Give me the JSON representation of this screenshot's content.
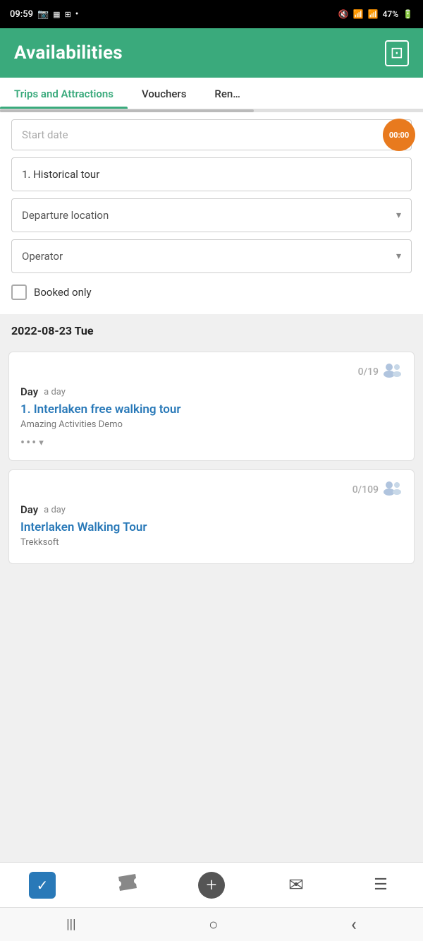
{
  "statusBar": {
    "time": "09:59",
    "battery": "47%",
    "icons": [
      "camera-icon",
      "sim-icon",
      "grid-icon",
      "dot-icon"
    ]
  },
  "header": {
    "title": "Availabilities",
    "layoutIcon": "⊡"
  },
  "tabs": [
    {
      "id": "trips",
      "label": "Trips and Attractions",
      "active": true
    },
    {
      "id": "vouchers",
      "label": "Vouchers",
      "active": false
    },
    {
      "id": "rentals",
      "label": "Ren…",
      "active": false
    }
  ],
  "filters": {
    "startDatePlaceholder": "Start date",
    "timerLabel": "00:00",
    "tourName": "1. Historical tour",
    "departureLocationLabel": "Departure location",
    "operatorLabel": "Operator",
    "bookedOnlyLabel": "Booked only"
  },
  "dateHeading": "2022-08-23 Tue",
  "cards": [
    {
      "id": "card1",
      "capacity": "0/19",
      "dayLabel": "Day",
      "daySubLabel": "a day",
      "tourName": "1. Interlaken free walking tour",
      "operator": "Amazing Activities Demo",
      "hasMore": true
    },
    {
      "id": "card2",
      "capacity": "0/109",
      "dayLabel": "Day",
      "daySubLabel": "a day",
      "tourName": "Interlaken Walking Tour",
      "operator": "Trekksoft",
      "hasMore": false
    }
  ],
  "bottomNav": {
    "items": [
      {
        "id": "checklist",
        "icon": "✓",
        "type": "check"
      },
      {
        "id": "tickets",
        "icon": "🎫",
        "type": "ticket"
      },
      {
        "id": "add",
        "icon": "+",
        "type": "plus"
      },
      {
        "id": "mail",
        "icon": "✉",
        "type": "mail"
      },
      {
        "id": "menu",
        "icon": "☰",
        "type": "menu"
      }
    ]
  },
  "androidNav": {
    "back": "‹",
    "home": "○",
    "recents": "|||"
  }
}
